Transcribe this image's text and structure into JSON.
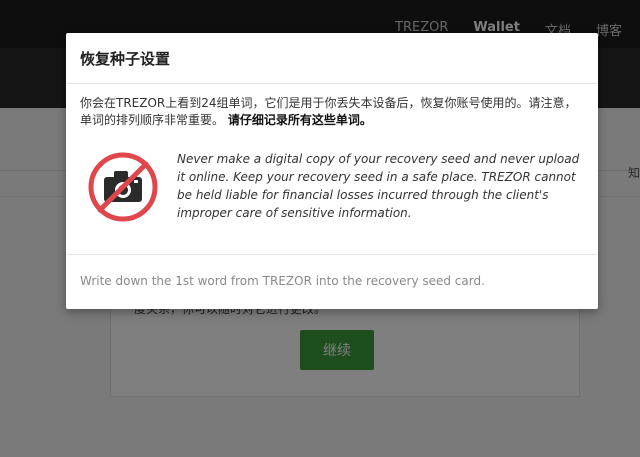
{
  "nav": {
    "items": [
      "TREZOR",
      "Wallet",
      "文档",
      "博客"
    ]
  },
  "background": {
    "card_text": "度关系，你可以随时对它进行更改。",
    "continue_label": "继续",
    "side_glyph": "知"
  },
  "modal": {
    "title": "恢复种子设置",
    "intro": "你会在TREZOR上看到24组单词，它们是用于你丢失本设备后，恢复你账号使用的。请注意，单词的排列顺序非常重要。",
    "intro_bold": "请仔细记录所有这些单词。",
    "warning_icon": "no-camera-icon",
    "warning_text": "Never make a digital copy of your recovery seed and never upload it online. Keep your recovery seed in a safe place. TREZOR cannot be held liable for financial losses incurred through the client's improper care of sensitive information.",
    "footer_instruction": "Write down the 1st word from TREZOR into the recovery seed card."
  },
  "colors": {
    "prohibit_red": "#e0474c",
    "camera_dark": "#2b2b2b",
    "button_green": "#3c9a3c"
  }
}
